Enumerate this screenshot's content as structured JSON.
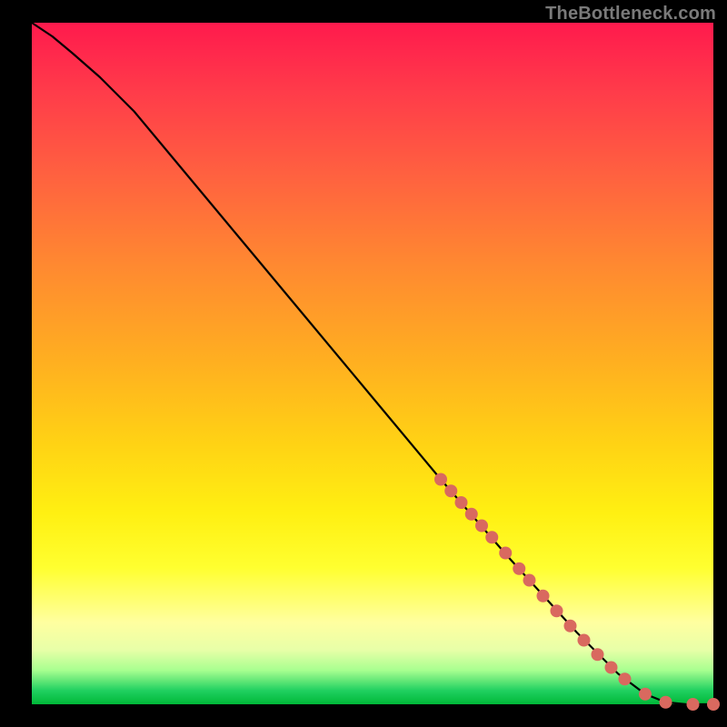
{
  "watermark": "TheBottleneck.com",
  "chart_data": {
    "type": "line",
    "title": "",
    "xlabel": "",
    "ylabel": "",
    "xlim": [
      0,
      100
    ],
    "ylim": [
      0,
      100
    ],
    "grid": false,
    "background_gradient": {
      "stops": [
        {
          "pos": 0.0,
          "color": "#ff1a4d"
        },
        {
          "pos": 0.22,
          "color": "#ff6040"
        },
        {
          "pos": 0.5,
          "color": "#ffb020"
        },
        {
          "pos": 0.72,
          "color": "#fff012"
        },
        {
          "pos": 0.88,
          "color": "#ffffa0"
        },
        {
          "pos": 0.95,
          "color": "#a8ff90"
        },
        {
          "pos": 1.0,
          "color": "#00b838"
        }
      ]
    },
    "series": [
      {
        "name": "bottleneck-curve",
        "color": "#000000",
        "x": [
          0,
          3,
          6,
          10,
          15,
          20,
          30,
          40,
          50,
          60,
          70,
          80,
          86,
          90,
          93,
          96,
          100
        ],
        "y": [
          100,
          98,
          95.5,
          92,
          87,
          81,
          69,
          57,
          45,
          33,
          21.5,
          10.5,
          4.5,
          1.5,
          0.3,
          0,
          0
        ]
      }
    ],
    "markers": {
      "name": "highlight-points",
      "color": "#d9695f",
      "radius_px": 7,
      "x": [
        60,
        61.5,
        63,
        64.5,
        66,
        67.5,
        69.5,
        71.5,
        73,
        75,
        77,
        79,
        81,
        83,
        85,
        87,
        90,
        93,
        97,
        100
      ],
      "y": [
        33,
        31.3,
        29.6,
        27.9,
        26.2,
        24.5,
        22.2,
        19.9,
        18.2,
        15.9,
        13.7,
        11.5,
        9.4,
        7.3,
        5.4,
        3.7,
        1.5,
        0.3,
        0,
        0
      ]
    }
  }
}
